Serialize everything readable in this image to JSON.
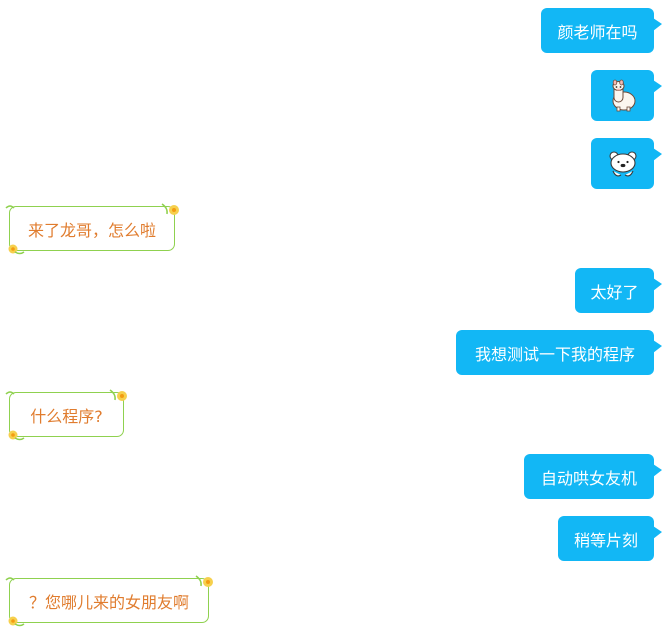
{
  "messages": [
    {
      "side": "right",
      "text": "颜老师在吗"
    },
    {
      "side": "right",
      "icon": "alpaca-emoji-icon"
    },
    {
      "side": "right",
      "icon": "polar-bear-emoji-icon"
    },
    {
      "side": "left",
      "text": "来了龙哥，怎么啦"
    },
    {
      "side": "right",
      "text": "太好了"
    },
    {
      "side": "right",
      "text": "我想测试一下我的程序"
    },
    {
      "side": "left",
      "text": "什么程序?"
    },
    {
      "side": "right",
      "text": "自动哄女友机"
    },
    {
      "side": "right",
      "text": "稍等片刻"
    },
    {
      "side": "left",
      "text": "？您哪儿来的女朋友啊"
    }
  ],
  "colors": {
    "sent_bubble": "#12b7f5",
    "sent_text": "#ffffff",
    "received_border": "#8fd14f",
    "received_text": "#e07c2e",
    "flower": "#f6d04d"
  }
}
